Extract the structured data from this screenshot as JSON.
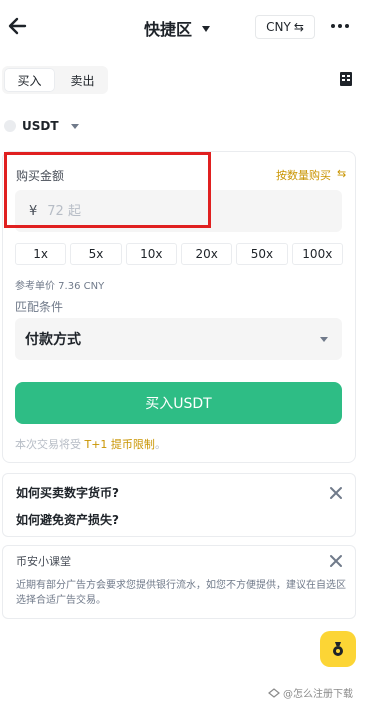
{
  "header": {
    "title": "快捷区",
    "currency": "CNY",
    "currency_swap_glyph": "⇆"
  },
  "tabs": [
    {
      "label": "买入",
      "active": true
    },
    {
      "label": "卖出",
      "active": false
    }
  ],
  "asset": {
    "symbol": "USDT"
  },
  "amount": {
    "label": "购买金额",
    "by_quantity_label": "按数量购买",
    "by_quantity_glyph": "⇆",
    "currency_symbol": "¥",
    "placeholder": "72 起"
  },
  "multipliers": [
    "1x",
    "5x",
    "10x",
    "20x",
    "50x",
    "100x"
  ],
  "reference_price": "参考单价 7.36 CNY",
  "match_conditions_label": "匹配条件",
  "payment_method": {
    "selected": "付款方式"
  },
  "buy_button_label": "买入USDT",
  "notice": {
    "prefix": "本次交易将受 ",
    "highlight": "T+1 提币限制",
    "suffix": "。"
  },
  "faq": {
    "items": [
      "如何买卖数字货币?",
      "如何避免资产损失?"
    ]
  },
  "academy": {
    "title": "币安小课堂",
    "body": "近期有部分广告方会要求您提供银行流水，如您不方便提供，建议在自选区选择合适广告交易。"
  },
  "watermark": "@怎么注册下载",
  "colors": {
    "accent_green": "#2ebd85",
    "brand_yellow": "#fcd535",
    "highlight_gold": "#c99400",
    "annotation_red": "#e02020"
  },
  "icons": {
    "back": "arrow-left-icon",
    "more": "more-dots-icon",
    "orders": "orders-list-icon",
    "close": "close-icon",
    "fab": "medal-icon"
  }
}
